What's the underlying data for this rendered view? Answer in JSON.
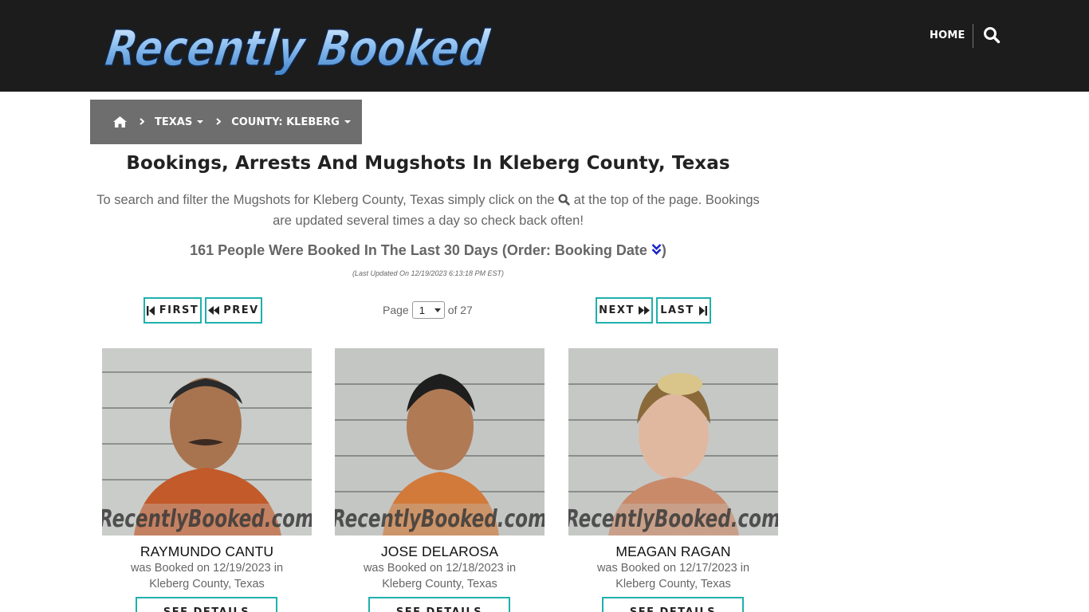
{
  "header": {
    "logo_text": "Recently Booked",
    "nav_home": "HOME",
    "search_icon": "search-icon"
  },
  "breadcrumb": {
    "home_icon": "home-icon",
    "state": "TEXAS",
    "county": "COUNTY: KLEBERG"
  },
  "main": {
    "title": "Bookings, Arrests And Mugshots In Kleberg County, Texas",
    "intro_before": "To search and filter the Mugshots for Kleberg County, Texas simply click on the",
    "intro_after": "at the top of the page. Bookings are updated several times a day so check back often!",
    "count_text": "161 People Were Booked In The Last 30 Days (Order: Booking Date",
    "count_close": ")",
    "updated": "(Last Updated On 12/19/2023 6:13:18 PM EST)"
  },
  "pagination": {
    "first": "FIRST",
    "prev": "PREV",
    "next": "NEXT",
    "last": "LAST",
    "page_label": "Page",
    "current_page": "1",
    "of_label": "of 27"
  },
  "colors": {
    "header_bg": "#1c1c1c",
    "breadcrumb_bg": "#6e6e6e",
    "accent": "#1fb0ad"
  },
  "bookings": [
    {
      "name": "RAYMUNDO CANTU",
      "line1": "was Booked on 12/19/2023 in",
      "line2": "Kleberg County, Texas",
      "watermark": "RecentlyBooked.com",
      "details": "SEE DETAILS"
    },
    {
      "name": "JOSE DELAROSA",
      "line1": "was Booked on 12/18/2023 in",
      "line2": "Kleberg County, Texas",
      "watermark": "RecentlyBooked.com",
      "details": "SEE DETAILS"
    },
    {
      "name": "MEAGAN RAGAN",
      "line1": "was Booked on 12/17/2023 in",
      "line2": "Kleberg County, Texas",
      "watermark": "RecentlyBooked.com",
      "details": "SEE DETAILS"
    }
  ]
}
